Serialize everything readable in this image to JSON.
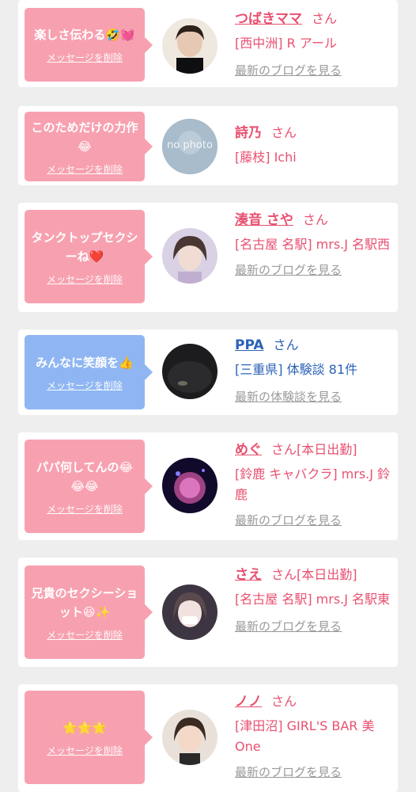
{
  "delete_label": "メッセージを削除",
  "san": "さん",
  "cards": [
    {
      "message": "楽しさ伝わる🤣💓",
      "name": "つばきママ",
      "shift": "",
      "shop": "[西中洲] R アール",
      "link": "最新のブログを見る"
    },
    {
      "message": "このためだけの力作😂",
      "name": "詩乃",
      "shift": "",
      "shop": "[藤枝] Ichi",
      "avatar_text": "no photo"
    },
    {
      "message": "タンクトップセクシーね❤️",
      "name": "湊音 さや",
      "shift": "",
      "shop": "[名古屋 名駅] mrs.J 名駅西",
      "link": "最新のブログを見る"
    },
    {
      "message": "みんなに笑顔を👍",
      "name": "PPA",
      "shift": "",
      "shop": "[三重県] 体験談 81件",
      "link": "最新の体験談を見る"
    },
    {
      "message": "パパ何してんの😂😂😂",
      "name": "めぐ",
      "shift": "[本日出勤]",
      "shop": "[鈴鹿 キャバクラ] mrs.J 鈴鹿",
      "link": "最新のブログを見る"
    },
    {
      "message": "兄貴のセクシーショット😆✨",
      "name": "さえ",
      "shift": "[本日出勤]",
      "shop": "[名古屋 名駅] mrs.J 名駅東",
      "link": "最新のブログを見る"
    },
    {
      "message": "🌟🌟🌟",
      "name": "ノノ",
      "shift": "",
      "shop": "[津田沼] GIRL'S BAR 美One",
      "link": "最新のブログを見る"
    }
  ],
  "colors": {
    "pink_bubble": "#f7a1b0",
    "blue_bubble": "#8fb6f2",
    "pink_text": "#e8506f",
    "blue_text": "#2b62b8"
  }
}
